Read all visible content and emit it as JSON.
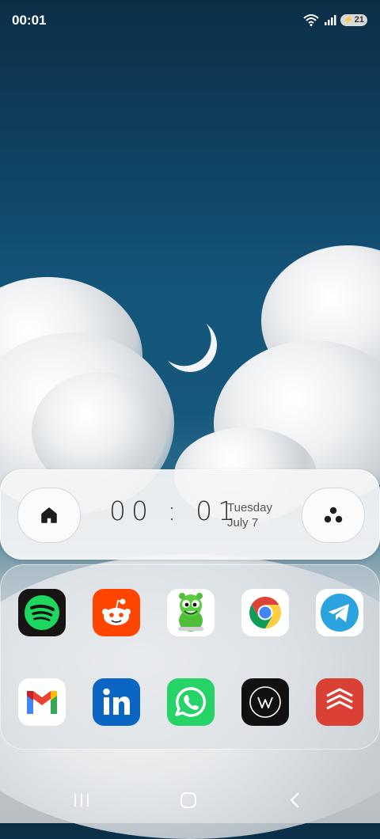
{
  "status_bar": {
    "time": "00:01",
    "battery_level": "21"
  },
  "widget": {
    "clock": "00 : 01",
    "day": "Tuesday",
    "date": "July 7"
  },
  "apps_row1": [
    {
      "name": "Spotify",
      "icon": "spotify-icon"
    },
    {
      "name": "Reddit",
      "icon": "reddit-icon"
    },
    {
      "name": "Gummy Bear",
      "icon": "gummy-bear-icon"
    },
    {
      "name": "Chrome",
      "icon": "chrome-icon"
    },
    {
      "name": "Telegram",
      "icon": "telegram-icon"
    }
  ],
  "apps_row2": [
    {
      "name": "Gmail",
      "icon": "gmail-icon"
    },
    {
      "name": "LinkedIn",
      "icon": "linkedin-icon"
    },
    {
      "name": "WhatsApp",
      "icon": "whatsapp-icon"
    },
    {
      "name": "Wattpad",
      "icon": "w-icon"
    },
    {
      "name": "Todoist",
      "icon": "todoist-icon"
    }
  ],
  "navigation": [
    "recent-apps",
    "home",
    "back"
  ],
  "colors": {
    "sky": "#14557a",
    "spotify": "#1ed760",
    "reddit": "#ff4500",
    "telegram": "#2aa3df",
    "linkedin": "#0a66c2",
    "whatsapp": "#25d366",
    "todoist": "#db4035"
  }
}
